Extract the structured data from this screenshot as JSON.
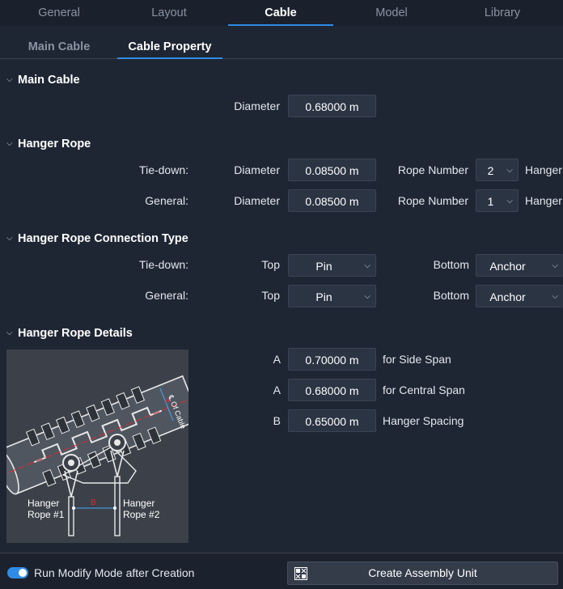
{
  "top_tabs": [
    "General",
    "Layout",
    "Cable",
    "Model",
    "Library"
  ],
  "top_tab_active": "Cable",
  "sub_tabs": [
    "Main Cable",
    "Cable Property"
  ],
  "sub_tab_active": "Cable Property",
  "main_cable": {
    "title": "Main Cable",
    "diameter_label": "Diameter",
    "diameter_value": "0.68000 m"
  },
  "hanger_rope": {
    "title": "Hanger Rope",
    "rows": [
      {
        "label": "Tie-down:",
        "diameter_label": "Diameter",
        "diameter_value": "0.08500 m",
        "rope_number_label": "Rope Number",
        "rope_number_value": "2",
        "trailing_label": "Hanger"
      },
      {
        "label": "General:",
        "diameter_label": "Diameter",
        "diameter_value": "0.08500 m",
        "rope_number_label": "Rope Number",
        "rope_number_value": "1",
        "trailing_label": "Hanger"
      }
    ]
  },
  "connection_type": {
    "title": "Hanger Rope Connection Type",
    "rows": [
      {
        "label": "Tie-down:",
        "top_label": "Top",
        "top_value": "Pin",
        "bottom_label": "Bottom",
        "bottom_value": "Anchor"
      },
      {
        "label": "General:",
        "top_label": "Top",
        "top_value": "Pin",
        "bottom_label": "Bottom",
        "bottom_value": "Anchor"
      }
    ]
  },
  "rope_details": {
    "title": "Hanger Rope Details",
    "diagram_labels": {
      "cable_axis": "℄ Of Cable",
      "rope1_line1": "Hanger",
      "rope1_line2": "Rope #1",
      "rope2_line1": "Hanger",
      "rope2_line2": "Rope #2",
      "dim_a": "A",
      "dim_b": "B"
    },
    "rows": [
      {
        "symbol": "A",
        "value": "0.70000 m",
        "description": "for Side Span"
      },
      {
        "symbol": "A",
        "value": "0.68000 m",
        "description": "for Central Span"
      },
      {
        "symbol": "B",
        "value": "0.65000 m",
        "description": "Hanger Spacing"
      }
    ]
  },
  "footer": {
    "toggle_label": "Run Modify Mode after Creation",
    "toggle_on": true,
    "create_button_label": "Create Assembly Unit"
  },
  "colors": {
    "accent": "#2f8ce6",
    "background": "#1f2633",
    "field": "#2b3443",
    "dimension_red": "#e0282d"
  },
  "icons": [
    "chevron-down-icon",
    "assembly-unit-icon"
  ]
}
